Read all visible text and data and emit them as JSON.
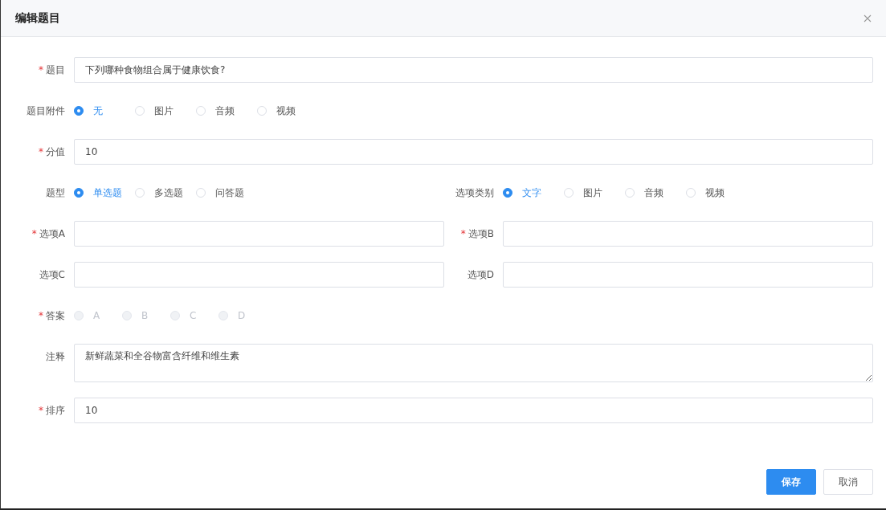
{
  "dialog": {
    "title": "编辑题目"
  },
  "rows": [
    {
      "kind": "input",
      "mark": "*",
      "label": "题目",
      "value": "下列哪种食物组合属于健康饮食?"
    },
    {
      "kind": "radio",
      "label": "题目附件",
      "disabled": false,
      "options": [
        {
          "label": "无",
          "selected": true
        },
        {
          "label": "图片",
          "selected": false
        },
        {
          "label": "音频",
          "selected": false
        },
        {
          "label": "视频",
          "selected": false
        }
      ]
    },
    {
      "kind": "input",
      "mark": "*",
      "label": "分值",
      "value": "10"
    },
    {
      "kind": "split",
      "cells": [
        {
          "kind": "radio",
          "label": "题型",
          "disabled": false,
          "options": [
            {
              "label": "单选题",
              "selected": true
            },
            {
              "label": "多选题",
              "selected": false
            },
            {
              "label": "问答题",
              "selected": false
            }
          ]
        },
        {
          "kind": "radio",
          "label": "选项类别",
          "disabled": false,
          "options": [
            {
              "label": "文字",
              "selected": true
            },
            {
              "label": "图片",
              "selected": false
            },
            {
              "label": "音频",
              "selected": false
            },
            {
              "label": "视频",
              "selected": false
            }
          ]
        }
      ]
    },
    {
      "kind": "split",
      "cells": [
        {
          "kind": "input",
          "mark": "*",
          "label": "选项A"
        },
        {
          "kind": "input",
          "mark": "*",
          "label": "选项B"
        }
      ]
    },
    {
      "kind": "split",
      "cells": [
        {
          "kind": "input",
          "label": "选项C"
        },
        {
          "kind": "input",
          "label": "选项D"
        }
      ]
    },
    {
      "kind": "radio",
      "mark": "*",
      "label": "答案",
      "disabled": true,
      "options": [
        {
          "label": "A",
          "selected": false
        },
        {
          "label": "B",
          "selected": false
        },
        {
          "label": "C",
          "selected": false
        },
        {
          "label": "D",
          "selected": false
        }
      ]
    },
    {
      "kind": "textarea",
      "label": "注释",
      "value": "新鲜蔬菜和全谷物富含纤维和维生素"
    },
    {
      "kind": "input",
      "mark": "*",
      "label": "排序",
      "value": "10"
    }
  ],
  "buttons": [
    {
      "label": "保存",
      "primary": true
    },
    {
      "label": "取消",
      "primary": false
    }
  ]
}
